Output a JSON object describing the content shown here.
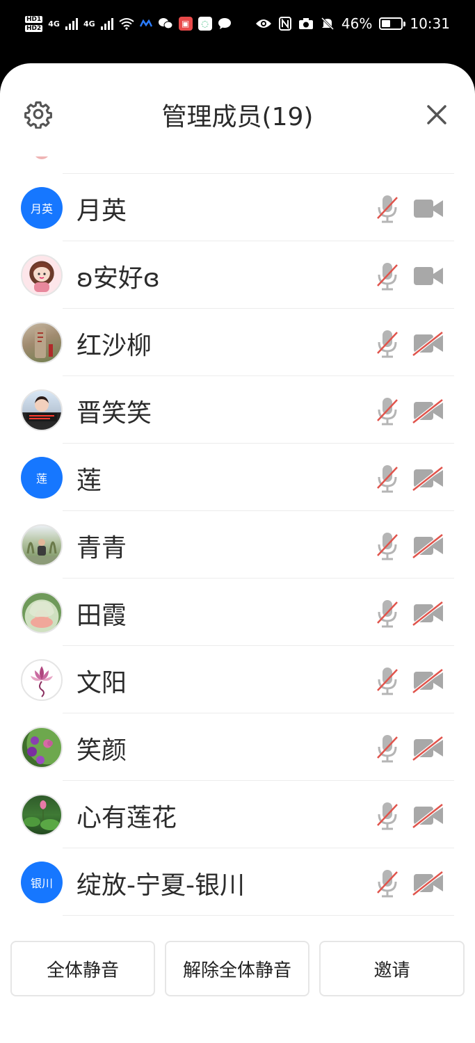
{
  "status_bar": {
    "network_labels": [
      "HD1",
      "HD2",
      "4G",
      "4G"
    ],
    "battery_percent": "46%",
    "battery_level": 0.46,
    "time": "10:31",
    "icons": [
      "signal-icon",
      "wifi-icon",
      "app-icon",
      "wechat-icon",
      "app-icon",
      "app-icon",
      "chat-icon",
      "eye-icon",
      "nfc-icon",
      "camera-icon",
      "mute-icon",
      "battery-icon"
    ]
  },
  "header": {
    "title": "管理成员(19)",
    "settings_icon": "gear-icon",
    "close_icon": "close-icon"
  },
  "members": [
    {
      "name": "月英",
      "avatar": "initials",
      "avatar_text": "月英",
      "mic": "muted",
      "camera": "on-gray"
    },
    {
      "name": "ʚ安好ɞ",
      "avatar": "photo",
      "avatar_theme": "cartoon-girl",
      "mic": "muted",
      "camera": "on-gray"
    },
    {
      "name": "红沙柳",
      "avatar": "photo",
      "avatar_theme": "stone-monument",
      "mic": "muted",
      "camera": "off"
    },
    {
      "name": "晋笑笑",
      "avatar": "photo",
      "avatar_theme": "portrait",
      "mic": "muted",
      "camera": "off"
    },
    {
      "name": "莲",
      "avatar": "initials",
      "avatar_text": "莲",
      "mic": "muted",
      "camera": "off"
    },
    {
      "name": "青青",
      "avatar": "photo",
      "avatar_theme": "trees",
      "mic": "muted",
      "camera": "off"
    },
    {
      "name": "田霞",
      "avatar": "photo",
      "avatar_theme": "jade",
      "mic": "muted",
      "camera": "off"
    },
    {
      "name": "文阳",
      "avatar": "photo",
      "avatar_theme": "lotus-drawing",
      "mic": "muted",
      "camera": "off"
    },
    {
      "name": "笑颜",
      "avatar": "photo",
      "avatar_theme": "purple-flowers",
      "mic": "muted",
      "camera": "off"
    },
    {
      "name": "心有莲花",
      "avatar": "photo",
      "avatar_theme": "lotus-pond",
      "mic": "muted",
      "camera": "off"
    },
    {
      "name": "绽放-宁夏-银川",
      "avatar": "initials",
      "avatar_text": "银川",
      "mic": "muted",
      "camera": "off"
    }
  ],
  "footer": {
    "mute_all": "全体静音",
    "unmute_all": "解除全体静音",
    "invite": "邀请"
  },
  "colors": {
    "accent": "#1677ff",
    "icon_gray": "#b5b5b5",
    "mute_red": "#e0544c"
  }
}
